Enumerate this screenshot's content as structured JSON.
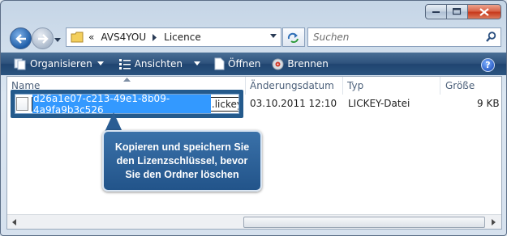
{
  "address": {
    "overflow": "«",
    "path": [
      "AVS4YOU",
      "Licence"
    ]
  },
  "search": {
    "placeholder": "Suchen"
  },
  "commands": {
    "organize": "Organisieren",
    "views": "Ansichten",
    "open": "Öffnen",
    "burn": "Brennen",
    "help": "?"
  },
  "columns": {
    "name": "Name",
    "date": "Änderungsdatum",
    "type": "Typ",
    "size": "Größe"
  },
  "file": {
    "name_selected": "d26a1e07-c213-49e1-8b09-4a9fa9b3c526",
    "extension": ".lickey",
    "date": "03.10.2011 12:10",
    "type": "LICKEY-Datei",
    "size": "9 KB"
  },
  "callout": {
    "lines": [
      "Kopieren und speichern Sie",
      "den Lizenzschlüssel, bevor",
      "Sie den Ordner löschen"
    ]
  },
  "colors": {
    "command_bar": "#2e527c",
    "selection": "#3399ff",
    "callout": "#2a5d93",
    "close_button": "#c7381b"
  }
}
